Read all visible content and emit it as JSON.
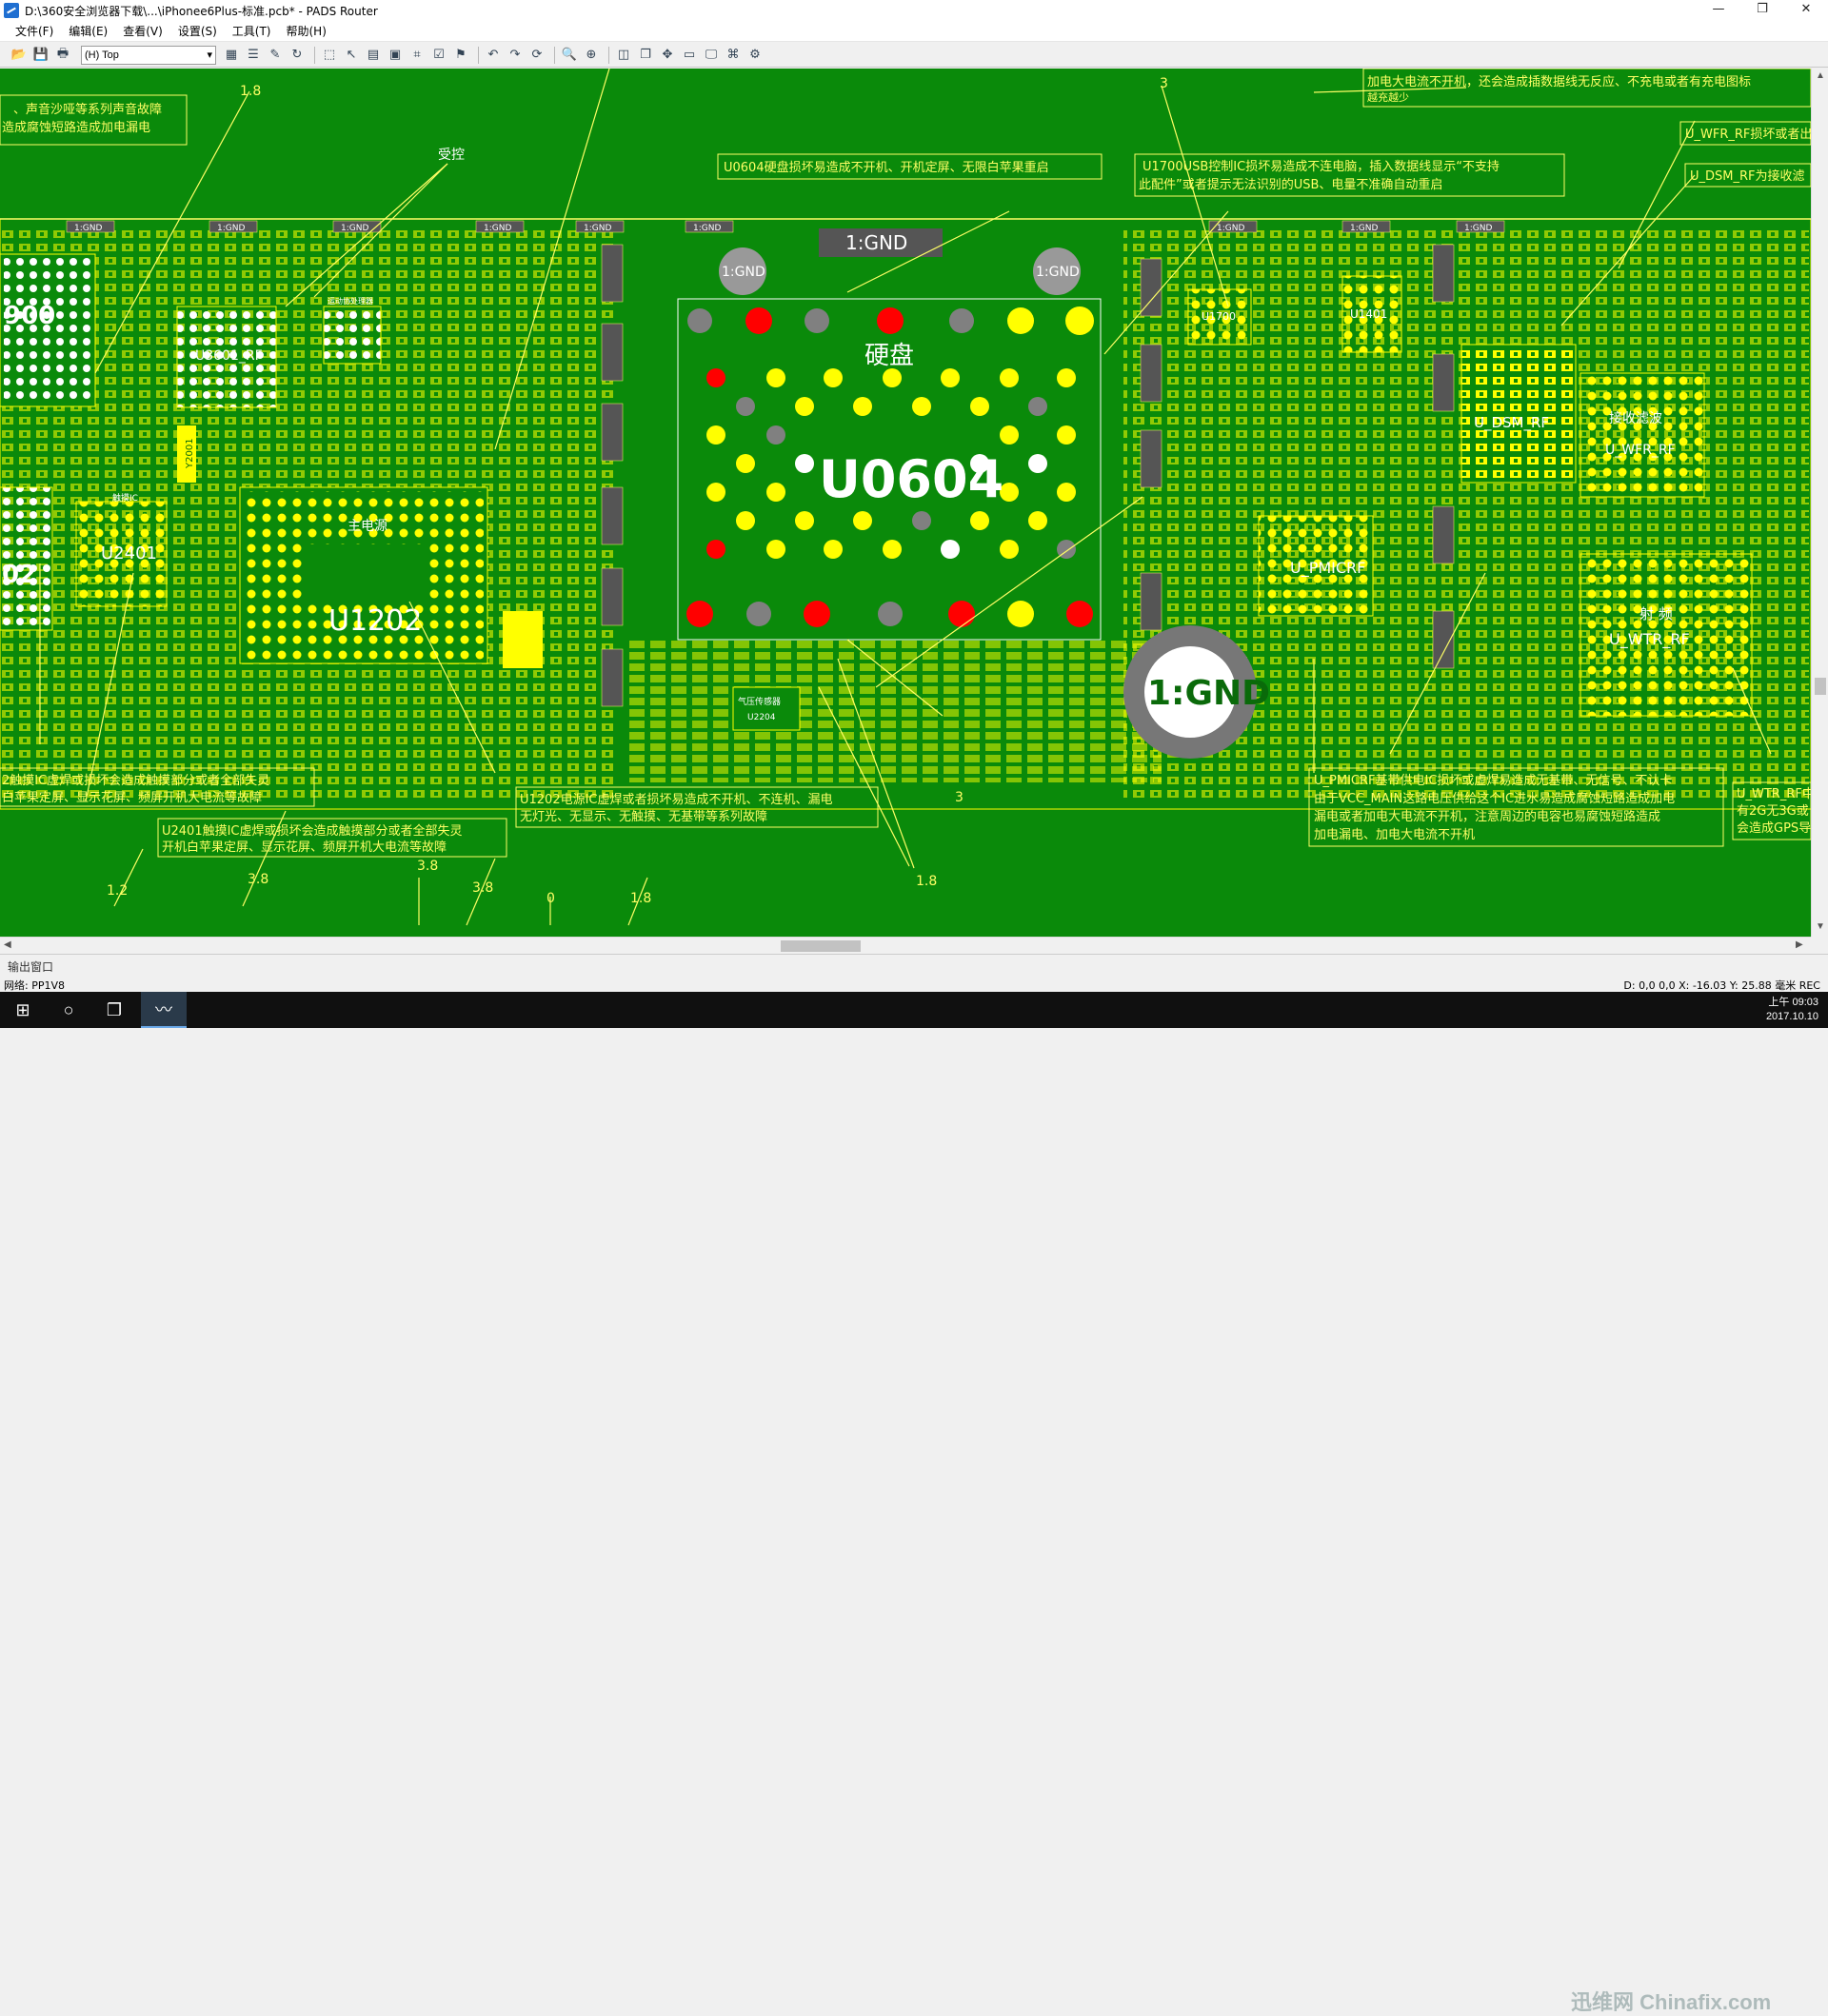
{
  "window": {
    "title": "D:\\360安全浏览器下载\\...\\iPhonee6Plus-标准.pcb* - PADS Router",
    "controls": [
      "—",
      "❐",
      "✕"
    ]
  },
  "menu": [
    "文件(F)",
    "编辑(E)",
    "查看(V)",
    "设置(S)",
    "工具(T)",
    "帮助(H)"
  ],
  "toolbar": {
    "layer_select": "(H) Top",
    "icons": [
      "open-icon",
      "save-icon",
      "print-icon",
      "layer-icon",
      "list-icon",
      "tool-icon",
      "refresh-icon",
      "select-icon",
      "cursor-icon",
      "grid-icon",
      "component-icon",
      "route-icon",
      "check-icon",
      "undo-icon",
      "redo-icon",
      "reload-icon",
      "zoom-icon",
      "zoom-area-icon",
      "view-icon",
      "window-icon",
      "pan-icon",
      "board-icon",
      "display-icon",
      "help-icon"
    ]
  },
  "colors": {
    "board_bg": "#0a8a0a",
    "copper": "#ffff00",
    "annotation": "#ffff66",
    "pad_red": "#ff0000",
    "pad_white": "#ffffff",
    "pad_gray": "#808080"
  },
  "annotations": [
    {
      "id": "a1",
      "lines": [
        "、声音沙哑等系列声音故障",
        "造成腐蚀短路造成加电漏电"
      ]
    },
    {
      "id": "a2",
      "lines": [
        "U0604硬盘损坏易造成不开机、开机定屏、无限白苹果重启"
      ]
    },
    {
      "id": "a3",
      "lines": [
        "U1700USB控制IC损坏易造成不连电脑，插入数据线显示“不支持",
        "此配件”或者提示无法识别的USB、电量不准确自动重启"
      ]
    },
    {
      "id": "a4",
      "lines": [
        "加电大电流不开机，还会造成插数据线无反应、不充电或者有充电图标",
        "越充越少"
      ]
    },
    {
      "id": "a5",
      "lines": [
        "U_WFR_RF损坏或者出"
      ]
    },
    {
      "id": "a6",
      "lines": [
        "U_DSM_RF为接收滤"
      ]
    },
    {
      "id": "a7",
      "lines": [
        "2触摸IC虚焊或损坏会造成触摸部分或者全部失灵",
        "白苹果定屏、显示花屏、频屏开机大电流等故障"
      ]
    },
    {
      "id": "a8",
      "lines": [
        "U1202电源IC虚焊或者损坏易造成不开机、不连机、漏电",
        "无灯光、无显示、无触摸、无基带等系列故障"
      ]
    },
    {
      "id": "a9",
      "lines": [
        "U2401触摸IC虚焊或损坏会造成触摸部分或者全部失灵",
        "开机白苹果定屏、显示花屏、频屏开机大电流等故障"
      ]
    },
    {
      "id": "a10",
      "lines": [
        "U_PMICRF基带供电IC损坏或虚焊易造成无基带、无信号、不认卡",
        "由于VCC_MAIN这路电压供给这个IC进水易造成腐蚀短路造成加电",
        "漏电或者加电大电流不开机，注意周边的电容也易腐蚀短路造成",
        "加电漏电、加电大电流不开机"
      ]
    },
    {
      "id": "a11",
      "lines": [
        "U_WTR_RF中频",
        "有2G无3G或",
        "会造成GPS导"
      ]
    }
  ],
  "labels": {
    "gnd": "1:GND",
    "gnd_big": "1:GND",
    "u0604": "U0604",
    "harddisk": "硬盘",
    "u1202": "U1202",
    "main_power": "主电源",
    "u3601": "U3601_RF",
    "u2401": "U2401",
    "u_pmicrf": "U_PMICRF",
    "u_wtr_rf": "U_WTR_RF",
    "u_wfr_rf": "U_WFR_RF",
    "u_dsm_rf": "U_DSM_RF",
    "u1700": "U1700",
    "u1401": "U1401",
    "rf_label": "射 频",
    "recv": "接收滤波",
    "u_freq": "中频",
    "num_900": "900",
    "num_02": "02",
    "touch_ic": "触摸IC",
    "accel": "运动协处理器",
    "air_pressure": "气压传感器",
    "u2204": "U2204",
    "ctrl": "受控",
    "y2001": "Y2001",
    "u1202_2": "U1202",
    "v18a": "1.8",
    "v3a": "3",
    "v3b": "3",
    "v18b": "1.8",
    "v12": "1.2",
    "v38a": "3.8",
    "v38b": "3.8",
    "v38c": "3.8",
    "v0": "0",
    "v18c": "1.8"
  },
  "output_panel": "输出窗口",
  "status": {
    "net": "网络: PP1V8",
    "coords": "D: 0,0 0,0   X: -16.03   Y: 25.88   毫米   REC"
  },
  "taskbar": {
    "time": "上午 09:03",
    "date": "2017.10.10",
    "watermark": "迅维网 Chinafix.com"
  }
}
